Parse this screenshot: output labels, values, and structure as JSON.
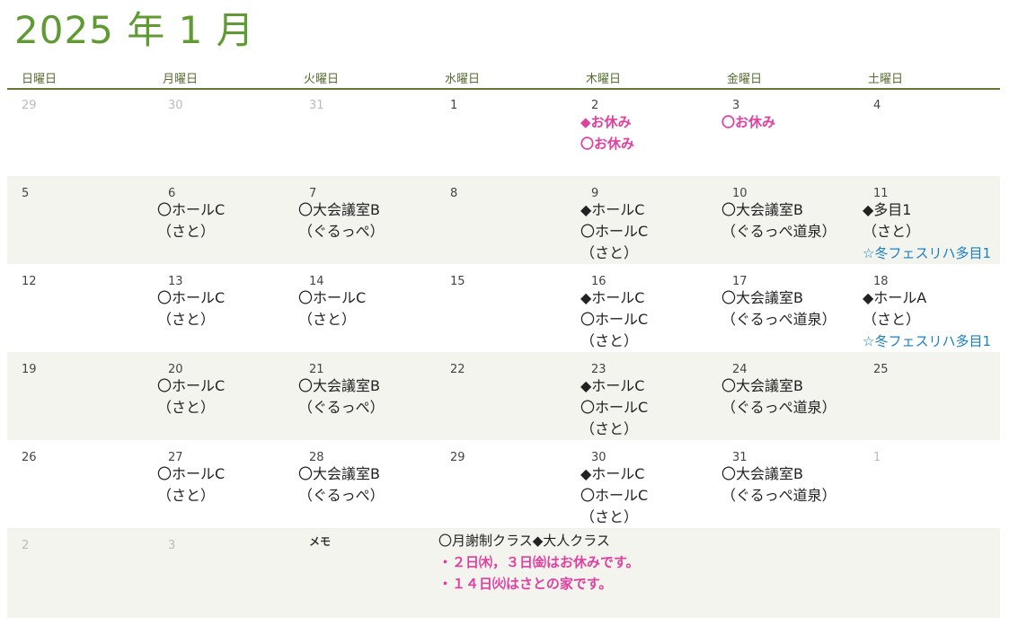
{
  "title": "2025 年 1 月",
  "weekdays": [
    "日曜日",
    "月曜日",
    "火曜日",
    "水曜日",
    "木曜日",
    "金曜日",
    "土曜日"
  ],
  "colors": {
    "accent": "#5f9a33",
    "pink": "#e0409f",
    "blue": "#1a7fc4",
    "shade": "#f3f4ee"
  },
  "weeks": [
    {
      "days": [
        {
          "num": "29",
          "other": true,
          "events": []
        },
        {
          "num": "30",
          "other": true,
          "events": []
        },
        {
          "num": "31",
          "other": true,
          "events": []
        },
        {
          "num": "1",
          "events": []
        },
        {
          "num": "2",
          "events": [
            {
              "text": "◆お休み",
              "style": "pink"
            },
            {
              "text": "〇お休み",
              "style": "pink"
            }
          ]
        },
        {
          "num": "3",
          "events": [
            {
              "text": "〇お休み",
              "style": "pink"
            }
          ]
        },
        {
          "num": "4",
          "events": []
        }
      ]
    },
    {
      "days": [
        {
          "num": "5",
          "events": []
        },
        {
          "num": "6",
          "events": [
            {
              "text": "〇ホールC"
            },
            {
              "text": "（さと）"
            }
          ]
        },
        {
          "num": "7",
          "events": [
            {
              "text": "〇大会議室B"
            },
            {
              "text": "（ぐるっぺ）"
            }
          ]
        },
        {
          "num": "8",
          "events": []
        },
        {
          "num": "9",
          "events": [
            {
              "text": "◆ホールC"
            },
            {
              "text": "〇ホールC"
            },
            {
              "text": "（さと）"
            }
          ]
        },
        {
          "num": "10",
          "events": [
            {
              "text": "〇大会議室B"
            },
            {
              "text": "（ぐるっぺ道泉）"
            }
          ]
        },
        {
          "num": "11",
          "events": [
            {
              "text": "◆多目1"
            },
            {
              "text": "（さと）"
            },
            {
              "text": "☆冬フェスリハ多目1",
              "style": "blue"
            }
          ]
        }
      ]
    },
    {
      "days": [
        {
          "num": "12",
          "events": []
        },
        {
          "num": "13",
          "events": [
            {
              "text": "〇ホールC"
            },
            {
              "text": "（さと）"
            }
          ]
        },
        {
          "num": "14",
          "events": [
            {
              "text": "〇ホールC"
            },
            {
              "text": "（さと）"
            }
          ]
        },
        {
          "num": "15",
          "events": []
        },
        {
          "num": "16",
          "events": [
            {
              "text": "◆ホールC"
            },
            {
              "text": "〇ホールC"
            },
            {
              "text": "（さと）"
            }
          ]
        },
        {
          "num": "17",
          "events": [
            {
              "text": "〇大会議室B"
            },
            {
              "text": "（ぐるっぺ道泉）"
            }
          ]
        },
        {
          "num": "18",
          "events": [
            {
              "text": "◆ホールA"
            },
            {
              "text": "（さと）"
            },
            {
              "text": "☆冬フェスリハ多目1",
              "style": "blue"
            }
          ]
        }
      ]
    },
    {
      "days": [
        {
          "num": "19",
          "events": []
        },
        {
          "num": "20",
          "events": [
            {
              "text": "〇ホールC"
            },
            {
              "text": "（さと）"
            }
          ]
        },
        {
          "num": "21",
          "events": [
            {
              "text": "〇大会議室B"
            },
            {
              "text": "（ぐるっぺ）"
            }
          ]
        },
        {
          "num": "22",
          "events": []
        },
        {
          "num": "23",
          "events": [
            {
              "text": "◆ホールC"
            },
            {
              "text": "〇ホールC"
            },
            {
              "text": "（さと）"
            }
          ]
        },
        {
          "num": "24",
          "events": [
            {
              "text": "〇大会議室B"
            },
            {
              "text": "（ぐるっぺ道泉）"
            }
          ]
        },
        {
          "num": "25",
          "events": []
        }
      ]
    },
    {
      "days": [
        {
          "num": "26",
          "events": []
        },
        {
          "num": "27",
          "events": [
            {
              "text": "〇ホールC"
            },
            {
              "text": "（さと）"
            }
          ]
        },
        {
          "num": "28",
          "events": [
            {
              "text": "〇大会議室B"
            },
            {
              "text": "（ぐるっぺ）"
            }
          ]
        },
        {
          "num": "29",
          "events": []
        },
        {
          "num": "30",
          "events": [
            {
              "text": "◆ホールC"
            },
            {
              "text": "〇ホールC"
            },
            {
              "text": "（さと）"
            }
          ]
        },
        {
          "num": "31",
          "events": [
            {
              "text": "〇大会議室B"
            },
            {
              "text": "（ぐるっぺ道泉）"
            }
          ]
        },
        {
          "num": "1",
          "other": true,
          "events": []
        }
      ]
    }
  ],
  "last_row": {
    "days": [
      {
        "num": "2",
        "other": true
      },
      {
        "num": "3",
        "other": true
      }
    ],
    "memo_label": "メモ",
    "memo_lines": [
      {
        "text": "〇月謝制クラス◆大人クラス"
      },
      {
        "text": "・２日㈭，３日㈮はお休みです。",
        "style": "pink"
      },
      {
        "text": "・１４日㈫はさとの家です。",
        "style": "pink"
      }
    ]
  }
}
